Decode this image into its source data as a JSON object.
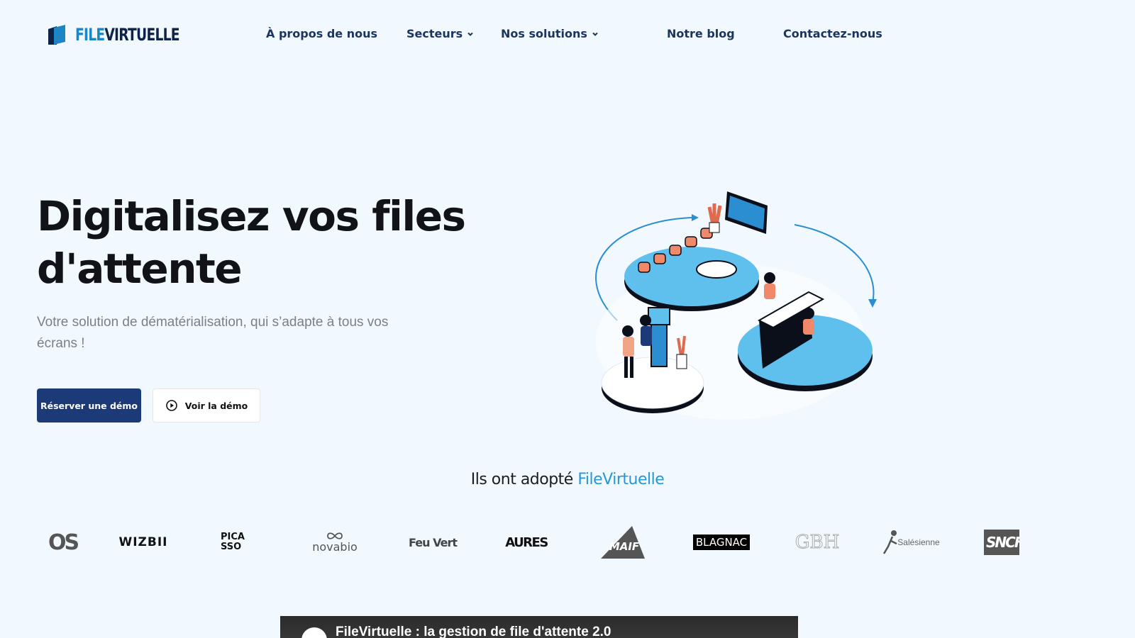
{
  "brand": {
    "logo_text_part1": "FILE",
    "logo_text_part2": "VIRTUELLE",
    "colors": {
      "primary": "#1d3a78",
      "accent": "#2798d3",
      "nav": "#1c3560",
      "background": "#f1f8fe"
    }
  },
  "nav": {
    "items": [
      {
        "label": "À propos de nous",
        "has_dropdown": false
      },
      {
        "label": "Secteurs",
        "has_dropdown": true
      },
      {
        "label": "Nos solutions",
        "has_dropdown": true
      },
      {
        "label": "Notre blog",
        "has_dropdown": false
      },
      {
        "label": "Contactez-nous",
        "has_dropdown": false
      }
    ]
  },
  "hero": {
    "title_line1": "Digitalisez vos files",
    "title_line2": "d'attente",
    "subtitle": "Votre solution de dématérialisation, qui s’adapte à tous vos écrans !",
    "primary_button": "Réserver une démo",
    "secondary_button": "Voir la démo",
    "illustration_icon": "queue-management-illustration"
  },
  "clients": {
    "heading_prefix": "Ils ont adopté ",
    "heading_accent": "FileVirtuelle",
    "logos": [
      {
        "name": "os-logo",
        "text": "OS"
      },
      {
        "name": "wizbii-logo",
        "text": "WIZBII"
      },
      {
        "name": "picasso-logo",
        "text": "PICASSO"
      },
      {
        "name": "novabio-logo",
        "text": "novabio"
      },
      {
        "name": "feuvert-logo",
        "text": "Feu Vert"
      },
      {
        "name": "aures-logo",
        "text": "AURES"
      },
      {
        "name": "maif-logo",
        "text": "MAIF"
      },
      {
        "name": "blagnac-logo",
        "text": "BLAGNAC"
      },
      {
        "name": "gbh-logo",
        "text": "GBH"
      },
      {
        "name": "salesienne-logo",
        "text": "Salésienne"
      },
      {
        "name": "sncf-logo",
        "text": "SNCF"
      }
    ]
  },
  "video": {
    "title": "FileVirtuelle : la gestion de file d'attente 2.0"
  }
}
